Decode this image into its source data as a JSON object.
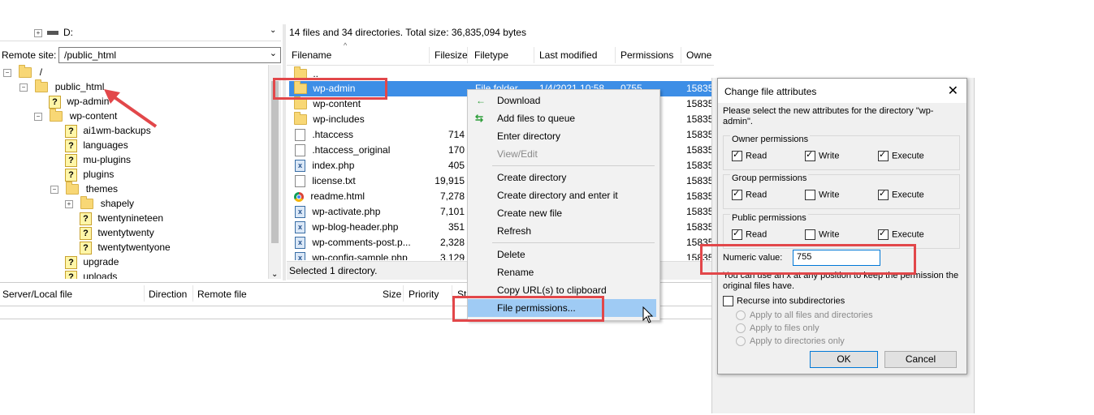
{
  "local_tree": {
    "drive_label": "D:"
  },
  "remote_site": {
    "label": "Remote site:",
    "path": "/public_html"
  },
  "remote_tree": {
    "items": [
      {
        "label": "/"
      },
      {
        "label": "public_html"
      },
      {
        "label": "wp-admin"
      },
      {
        "label": "wp-content"
      },
      {
        "label": "ai1wm-backups"
      },
      {
        "label": "languages"
      },
      {
        "label": "mu-plugins"
      },
      {
        "label": "plugins"
      },
      {
        "label": "themes"
      },
      {
        "label": "shapely"
      },
      {
        "label": "twentynineteen"
      },
      {
        "label": "twentytwenty"
      },
      {
        "label": "twentytwentyone"
      },
      {
        "label": "upgrade"
      },
      {
        "label": "uploads"
      }
    ]
  },
  "file_list": {
    "summary": "14 files and 34 directories. Total size: 36,835,094 bytes",
    "columns": [
      "Filename",
      "Filesize",
      "Filetype",
      "Last modified",
      "Permissions",
      "Owne"
    ],
    "rows": [
      {
        "name": "..",
        "size": "",
        "type": "",
        "modified": "",
        "perms": "",
        "owner": ""
      },
      {
        "name": "wp-admin",
        "size": "",
        "type": "File folder",
        "modified": "1/4/2021 10:58...",
        "perms": "0755",
        "owner": "15835"
      },
      {
        "name": "wp-content",
        "size": "",
        "type": "",
        "modified": "",
        "perms": "",
        "owner": "15835"
      },
      {
        "name": "wp-includes",
        "size": "",
        "type": "",
        "modified": "",
        "perms": "",
        "owner": "15835"
      },
      {
        "name": ".htaccess",
        "size": "714",
        "type": "",
        "modified": "",
        "perms": "",
        "owner": "15835"
      },
      {
        "name": ".htaccess_original",
        "size": "170",
        "type": "",
        "modified": "",
        "perms": "",
        "owner": "15835"
      },
      {
        "name": "index.php",
        "size": "405",
        "type": "",
        "modified": "",
        "perms": "",
        "owner": "15835"
      },
      {
        "name": "license.txt",
        "size": "19,915",
        "type": "",
        "modified": "",
        "perms": "",
        "owner": "15835"
      },
      {
        "name": "readme.html",
        "size": "7,278",
        "type": "",
        "modified": "",
        "perms": "",
        "owner": "15835"
      },
      {
        "name": "wp-activate.php",
        "size": "7,101",
        "type": "",
        "modified": "",
        "perms": "",
        "owner": "15835"
      },
      {
        "name": "wp-blog-header.php",
        "size": "351",
        "type": "",
        "modified": "",
        "perms": "",
        "owner": "15835"
      },
      {
        "name": "wp-comments-post.p...",
        "size": "2,328",
        "type": "",
        "modified": "",
        "perms": "",
        "owner": "15835"
      },
      {
        "name": "wp-config-sample.php",
        "size": "3,129",
        "type": "",
        "modified": "",
        "perms": "",
        "owner": "15835"
      }
    ],
    "status": "Selected 1 directory."
  },
  "queue": {
    "columns": [
      "Server/Local file",
      "Direction",
      "Remote file",
      "Size",
      "Priority",
      "St"
    ]
  },
  "context_menu": {
    "items": [
      {
        "label": "Download",
        "icon": "download-arrow-icon"
      },
      {
        "label": "Add files to queue",
        "icon": "add-queue-icon"
      },
      {
        "label": "Enter directory"
      },
      {
        "label": "View/Edit",
        "disabled": true
      },
      {
        "label": "Create directory"
      },
      {
        "label": "Create directory and enter it"
      },
      {
        "label": "Create new file"
      },
      {
        "label": "Refresh"
      },
      {
        "label": "Delete"
      },
      {
        "label": "Rename"
      },
      {
        "label": "Copy URL(s) to clipboard"
      },
      {
        "label": "File permissions..."
      }
    ]
  },
  "dialog": {
    "title": "Change file attributes",
    "intro": "Please select the new attributes for the directory \"wp-admin\".",
    "owner": {
      "label": "Owner permissions",
      "read": "Read",
      "write": "Write",
      "execute": "Execute"
    },
    "group": {
      "label": "Group permissions",
      "read": "Read",
      "write": "Write",
      "execute": "Execute"
    },
    "public": {
      "label": "Public permissions",
      "read": "Read",
      "write": "Write",
      "execute": "Execute"
    },
    "numeric_label": "Numeric value:",
    "numeric_value": "755",
    "hint": "You can use an x at any position to keep the permission the original files have.",
    "recurse_label": "Recurse into subdirectories",
    "apply_all": "Apply to all files and directories",
    "apply_files": "Apply to files only",
    "apply_dirs": "Apply to directories only",
    "ok": "OK",
    "cancel": "Cancel"
  }
}
